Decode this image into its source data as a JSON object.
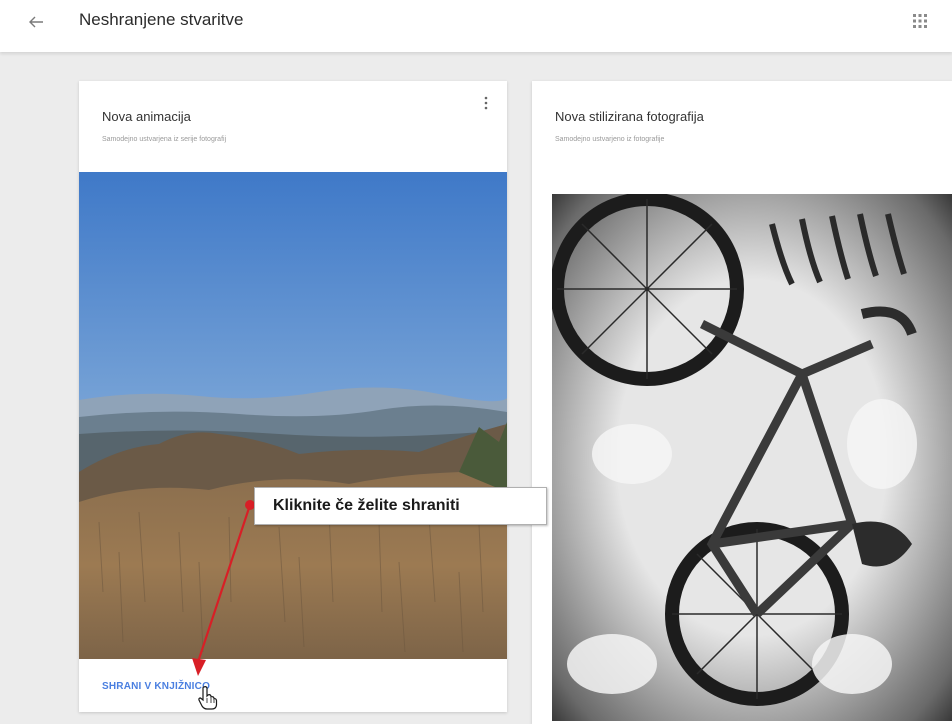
{
  "header": {
    "title": "Neshranjene stvaritve",
    "back_icon": "arrow-left-icon",
    "apps_icon": "apps-grid-icon"
  },
  "cards": [
    {
      "title": "Nova animacija",
      "subtitle": "Samodejno ustvarjena iz serije fotografij",
      "menu_icon": "more-vert-icon",
      "action_label": "SHRANI V KNJIŽNICO",
      "image": "landscape-photo"
    },
    {
      "title": "Nova stilizirana fotografija",
      "subtitle": "Samodejno ustvarjeno iz fotografije",
      "image": "bicycle-bw-photo"
    }
  ],
  "annotation": {
    "text": "Kliknite če želite shraniti",
    "color": "#d81f26"
  },
  "colors": {
    "accent": "#4a7fe0",
    "background": "#ececec"
  }
}
